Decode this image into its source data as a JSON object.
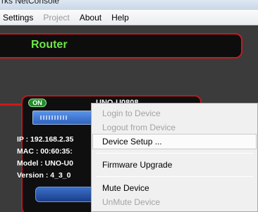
{
  "window": {
    "title_fragment": "rks NetConsole"
  },
  "menu_bar": [
    {
      "label": "Settings",
      "enabled": true
    },
    {
      "label": "Project",
      "enabled": false
    },
    {
      "label": "About",
      "enabled": true
    },
    {
      "label": "Help",
      "enabled": true
    }
  ],
  "router_panel": {
    "title": "Router"
  },
  "device": {
    "status": "ON",
    "name": "UNO-U0808",
    "ip": "IP : 192.168.2.35",
    "mac": "MAC : 00:60:35:",
    "model": "Model : UNO-U0",
    "version": "Version : 4_3_0",
    "button_label": "C"
  },
  "context_menu": {
    "items": [
      {
        "label": "Login to Device",
        "enabled": false
      },
      {
        "label": "Logout from Device",
        "enabled": false
      },
      {
        "label": "Device Setup ...",
        "enabled": true,
        "highlighted": true
      },
      {
        "separator": true
      },
      {
        "label": "Firmware Upgrade",
        "enabled": true
      },
      {
        "separator": true
      },
      {
        "label": "Mute Device",
        "enabled": true
      },
      {
        "label": "UnMute Device",
        "enabled": false
      }
    ]
  },
  "colors": {
    "router_title": "#6ee64a",
    "panel_border": "#c8191f",
    "status_on": "#1f8e2a",
    "device_blue": "#3b6fc8"
  }
}
